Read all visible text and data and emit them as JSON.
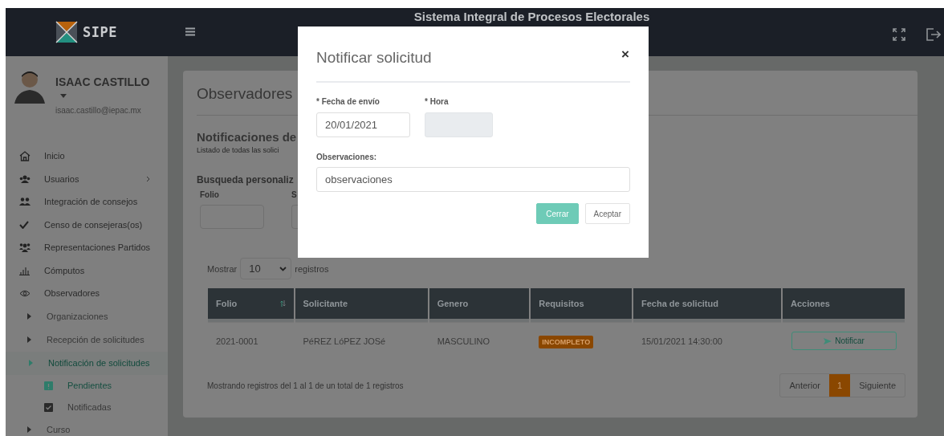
{
  "header": {
    "logo_text": "SIPE",
    "title": "Sistema Integral de Procesos Electorales"
  },
  "user": {
    "name": "ISAAC CASTILLO",
    "email": "isaac.castillo@iepac.mx"
  },
  "sidebar": {
    "items": [
      {
        "label": "Inicio",
        "kind": "home"
      },
      {
        "label": "Usuarios",
        "kind": "users",
        "expanded": false
      },
      {
        "label": "Integración de consejos",
        "kind": "group"
      },
      {
        "label": "Censo de consejeras(os)",
        "kind": "check"
      },
      {
        "label": "Representaciones Partidos",
        "kind": "team"
      },
      {
        "label": "Cómputos",
        "kind": "chart"
      },
      {
        "label": "Observadores",
        "kind": "eye",
        "expanded": true,
        "children": [
          {
            "label": "Organizaciones",
            "selected": false
          },
          {
            "label": "Recepción de solicitudes",
            "selected": false
          },
          {
            "label": "Notificación de solicitudes",
            "selected": true,
            "children": [
              {
                "label": "Pendientes",
                "kind": "alert",
                "selected": true
              },
              {
                "label": "Notificadas",
                "kind": "done",
                "selected": false
              }
            ]
          },
          {
            "label": "Curso",
            "selected": false
          }
        ]
      }
    ]
  },
  "page": {
    "title": "Observadores",
    "section_title": "Notificaciones de",
    "section_subtitle": "Listado de todas las solici",
    "search": {
      "title": "Busqueda personaliz",
      "fields": [
        {
          "label": "Folio"
        },
        {
          "label": "S"
        }
      ]
    },
    "table": {
      "length_before": "Mostrar",
      "length_value": "10",
      "length_after": "registros",
      "columns": [
        {
          "label": "Folio",
          "sortable": true
        },
        {
          "label": "Solicitante",
          "sortable": false
        },
        {
          "label": "Genero",
          "sortable": false
        },
        {
          "label": "Requisitos",
          "sortable": false
        },
        {
          "label": "Fecha de solicitud",
          "sortable": false
        },
        {
          "label": "Acciones",
          "sortable": false
        }
      ],
      "rows": [
        {
          "folio": "2021-0001",
          "solicitante": "PéREZ LóPEZ JOSé",
          "genero": "MASCULINO",
          "requisitos": "INCOMPLETO",
          "fecha": "15/01/2021 14:30:00",
          "action": "Notificar"
        }
      ],
      "info": "Mostrando registros del 1 al 1 de un total de 1 registros",
      "pagination": [
        {
          "label": "Anterior",
          "selected": false
        },
        {
          "label": "1",
          "selected": true
        },
        {
          "label": "Siguiente",
          "selected": false
        }
      ]
    }
  },
  "modal": {
    "title": "Notificar solicitud",
    "close": "×",
    "fields": [
      {
        "label": "* Fecha de envío",
        "value": "20/01/2021",
        "disabled": false
      },
      {
        "label": "* Hora",
        "disabled": true
      }
    ],
    "observations": {
      "label": "Observaciones:",
      "value": "observaciones"
    },
    "buttons": [
      {
        "label": "Cerrar",
        "kind": "primary"
      },
      {
        "label": "Aceptar",
        "kind": "default"
      }
    ]
  }
}
